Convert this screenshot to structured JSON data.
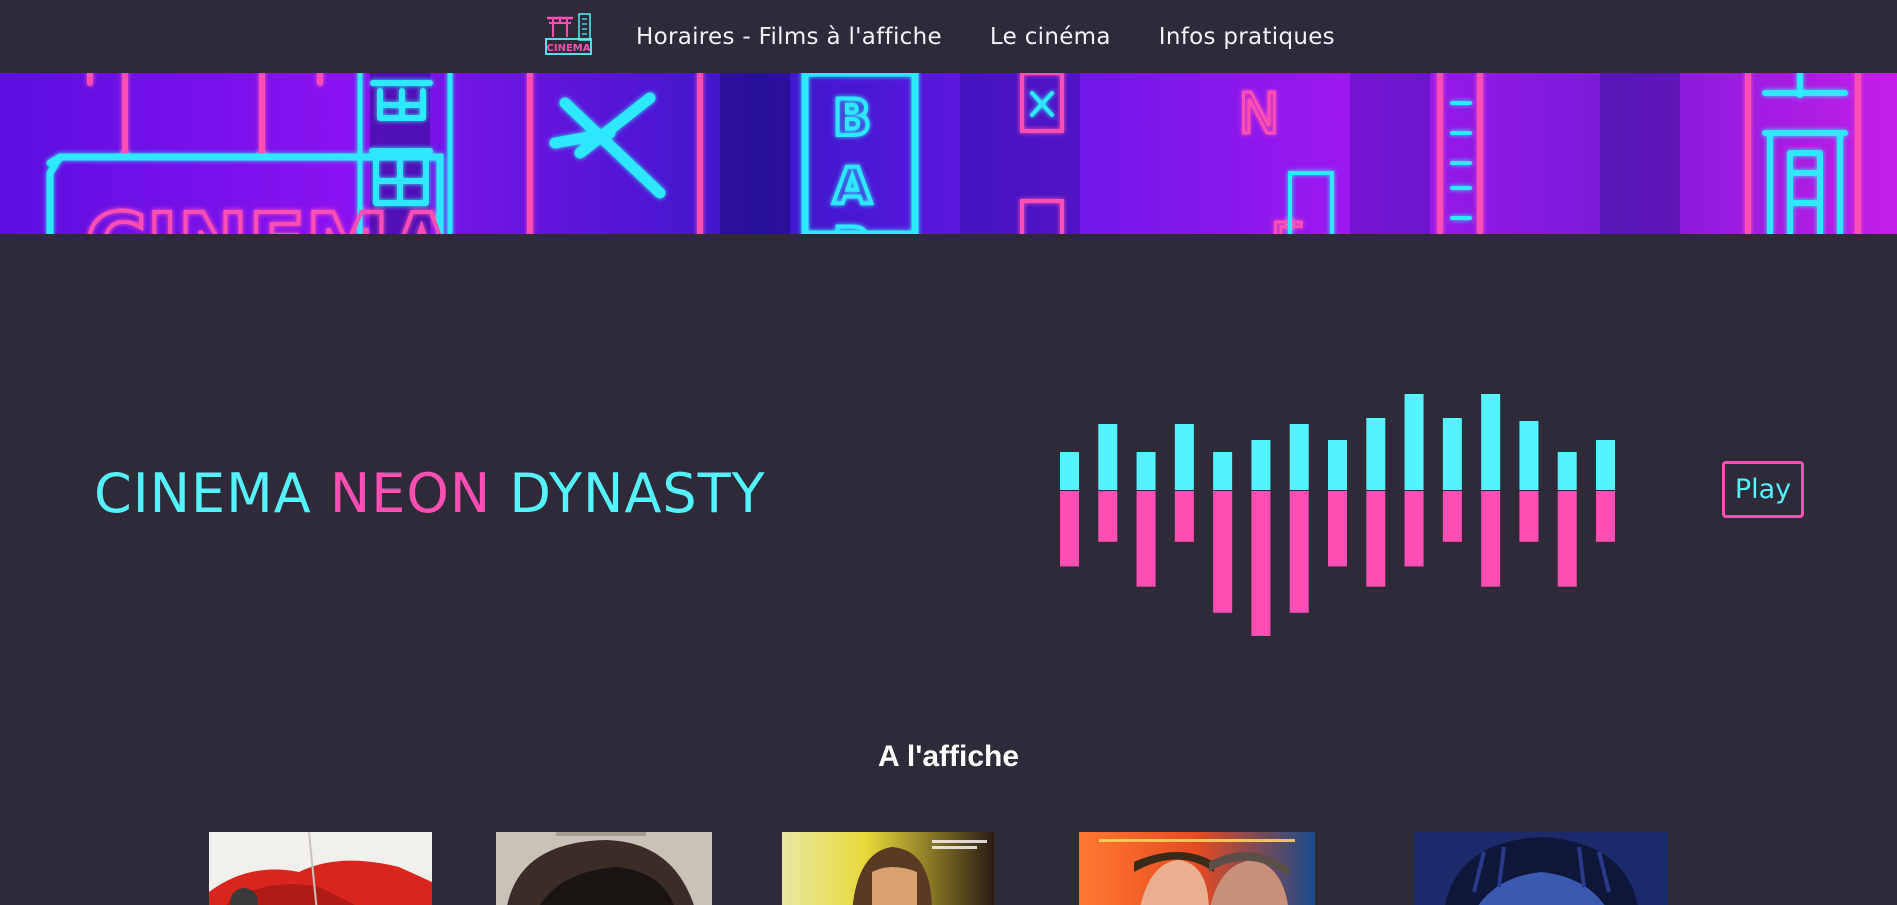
{
  "nav": {
    "logo_text": "CINEMA",
    "links": [
      "Horaires - Films à l'affiche",
      "Le cinéma",
      "Infos pratiques"
    ]
  },
  "hero": {
    "title_part1": "CINEMA ",
    "title_part2": "NEON",
    "title_part3": " DYNASTY",
    "play_label": "Play"
  },
  "section": {
    "title": "A l'affiche"
  },
  "colors": {
    "background": "#2e2a37",
    "cyan": "#55f2ff",
    "pink": "#ff4fb4"
  },
  "equalizer": {
    "up_levels": [
      0.38,
      0.66,
      0.38,
      0.66,
      0.38,
      0.5,
      0.66,
      0.5,
      0.72,
      0.96,
      0.72,
      0.96,
      0.69,
      0.38,
      0.5
    ],
    "down_levels": [
      0.52,
      0.35,
      0.66,
      0.35,
      0.84,
      1.0,
      0.84,
      0.52,
      0.66,
      0.52,
      0.35,
      0.66,
      0.35,
      0.66,
      0.35
    ]
  },
  "posters": [
    {
      "name": "poster-akira",
      "colors": [
        "#f2f0ec",
        "#d8261e",
        "#b01a14"
      ]
    },
    {
      "name": "poster-portrait",
      "colors": [
        "#c9c2b8",
        "#3a2c26",
        "#1a1412"
      ]
    },
    {
      "name": "poster-blade-runner",
      "colors": [
        "#e8d83a",
        "#5a3a22",
        "#201410"
      ]
    },
    {
      "name": "poster-blade-runner-2049",
      "colors": [
        "#e64a22",
        "#1a3a6a",
        "#ff8a40"
      ]
    },
    {
      "name": "poster-ghost-in-the-shell",
      "colors": [
        "#1a2a6a",
        "#0e163a",
        "#3a5ab0"
      ]
    }
  ]
}
